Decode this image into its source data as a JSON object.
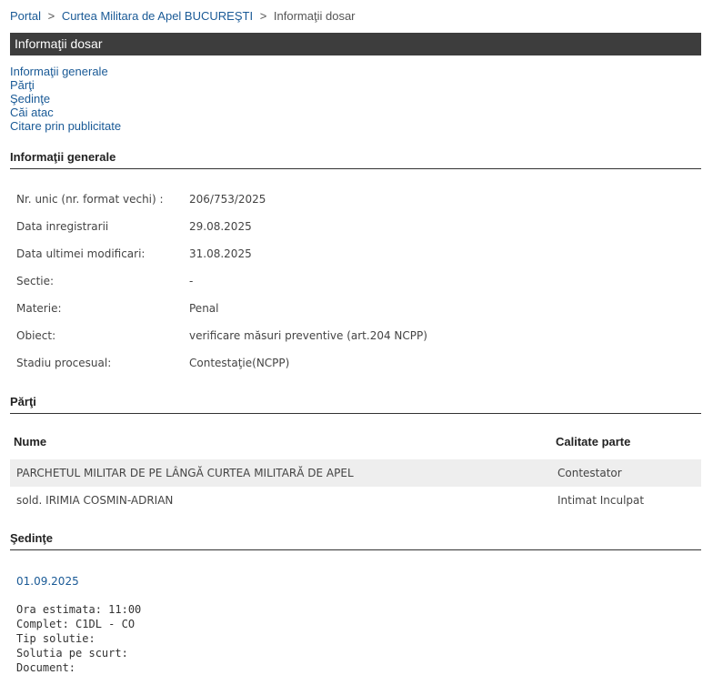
{
  "breadcrumb": {
    "portal": "Portal",
    "sep1": ">",
    "court": "Curtea Militara de Apel BUCUREŞTI",
    "sep2": ">",
    "current": "Informaţii dosar"
  },
  "title": "Informaţii dosar",
  "nav_links": [
    "Informaţii generale",
    "Părţi",
    "Şedinţe",
    "Căi atac",
    "Citare prin publicitate"
  ],
  "general": {
    "heading": "Informaţii generale",
    "rows": [
      {
        "label": "Nr. unic (nr. format vechi) :",
        "value": "206/753/2025"
      },
      {
        "label": "Data inregistrarii",
        "value": "29.08.2025"
      },
      {
        "label": "Data ultimei modificari:",
        "value": "31.08.2025"
      },
      {
        "label": "Sectie:",
        "value": "-"
      },
      {
        "label": "Materie:",
        "value": "Penal"
      },
      {
        "label": "Obiect:",
        "value": "verificare măsuri preventive (art.204 NCPP)"
      },
      {
        "label": "Stadiu procesual:",
        "value": "Contestaţie(NCPP)"
      }
    ]
  },
  "parties": {
    "heading": "Părţi",
    "col_name": "Nume",
    "col_role": "Calitate parte",
    "rows": [
      {
        "name": "PARCHETUL MILITAR DE PE LÂNGĂ CURTEA MILITARĂ DE APEL",
        "role": "Contestator"
      },
      {
        "name": "sold. IRIMIA COSMIN-ADRIAN",
        "role": "Intimat Inculpat"
      }
    ]
  },
  "sessions": {
    "heading": "Şedinţe",
    "date": "01.09.2025",
    "details": [
      "Ora estimata: 11:00",
      "Complet: C1DL - CO",
      "Tip solutie:",
      "Solutia pe scurt:",
      "Document:"
    ]
  }
}
